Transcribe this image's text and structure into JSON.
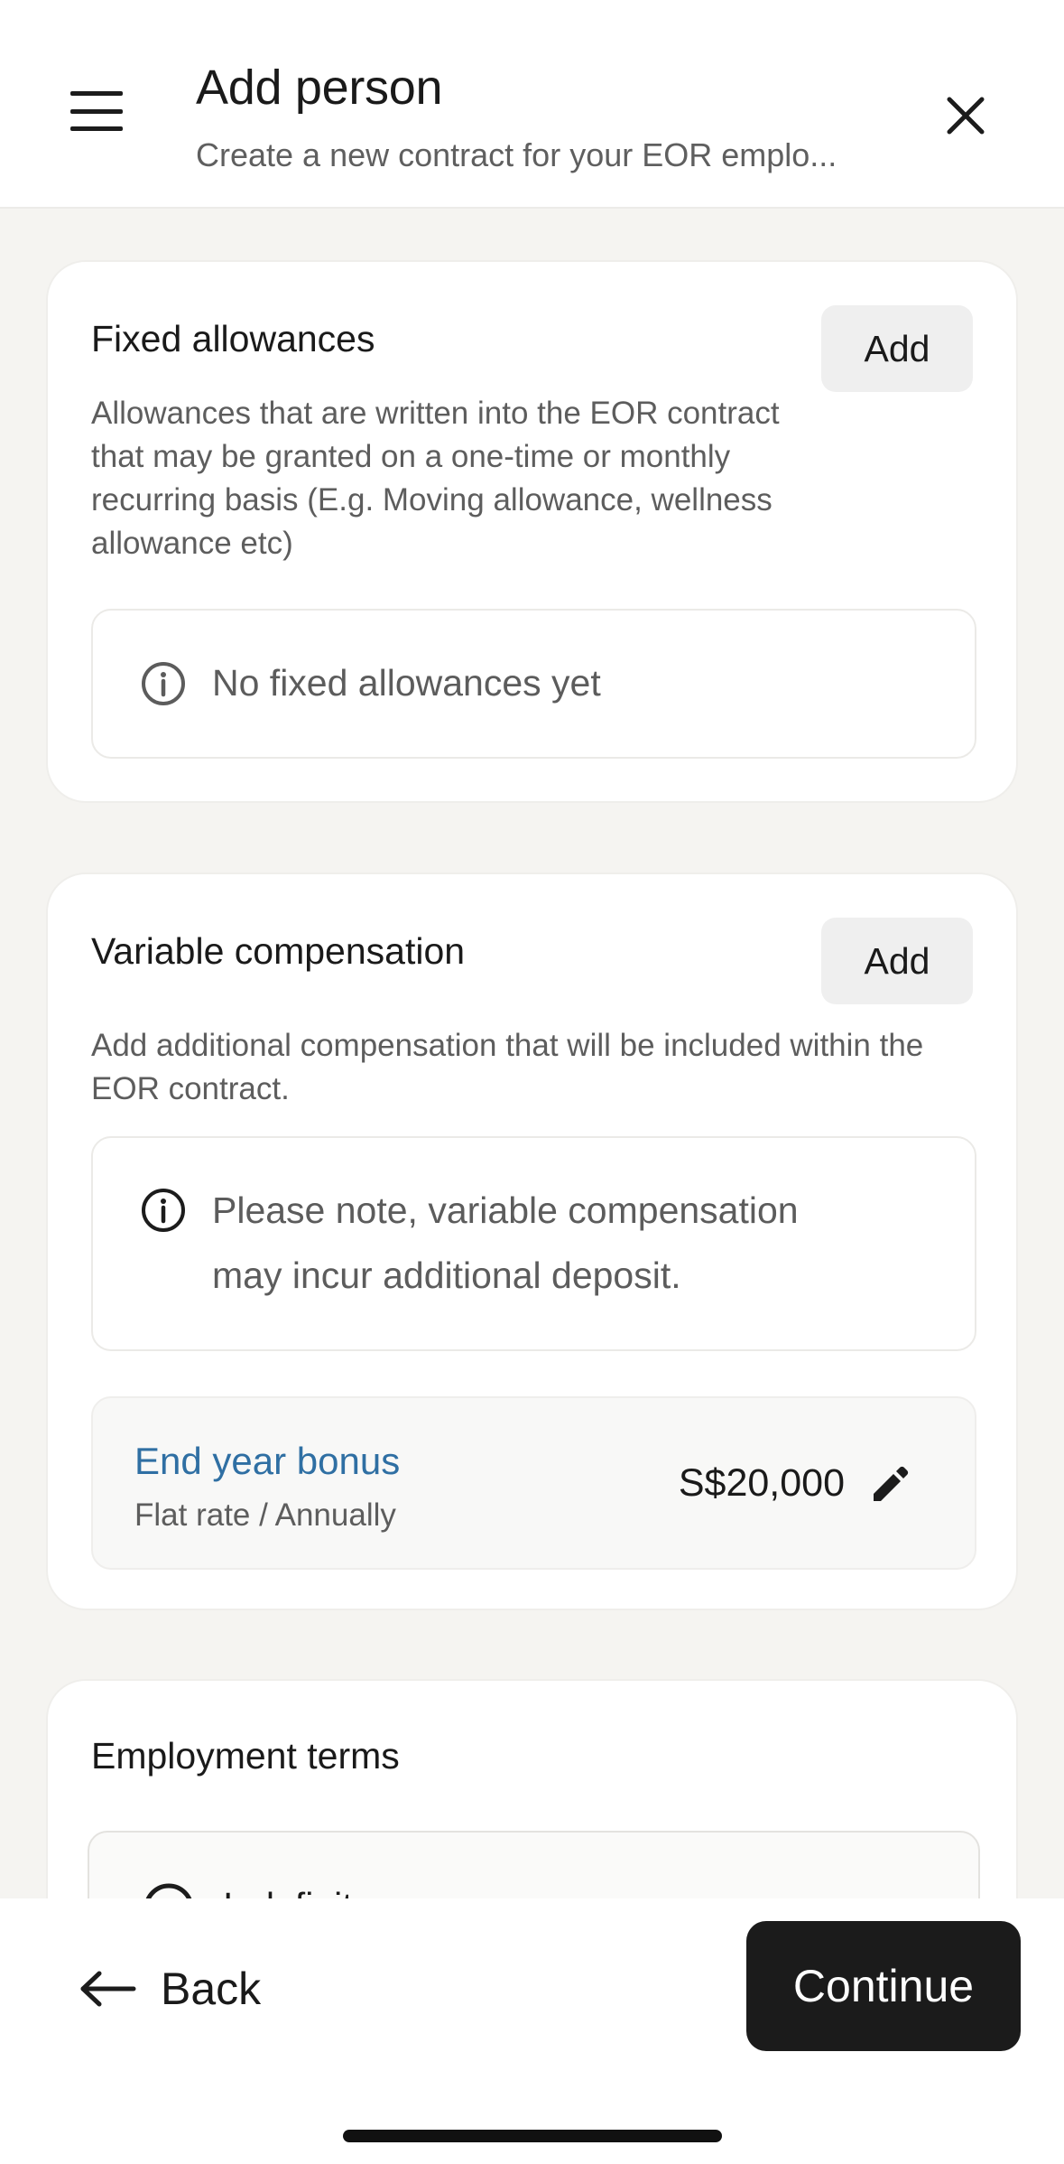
{
  "header": {
    "title": "Add person",
    "subtitle": "Create a new contract for your EOR emplo..."
  },
  "fixed_allowances": {
    "title": "Fixed allowances",
    "add_label": "Add",
    "description": "Allowances that are written into the EOR contract that may be granted on a one-time or monthly recurring basis (E.g. Moving allowance, wellness allowance etc)",
    "empty_text": "No fixed allowances yet"
  },
  "variable_compensation": {
    "title": "Variable compensation",
    "add_label": "Add",
    "description": "Add additional compensation that will be included within the EOR contract.",
    "note_line1": "Please note, variable compensation",
    "note_line2": "may incur additional deposit.",
    "items": [
      {
        "name": "End year bonus",
        "meta": "Flat rate / Annually",
        "amount": "S$20,000"
      }
    ]
  },
  "employment_terms": {
    "title": "Employment terms",
    "option_label": "Indefinite"
  },
  "footer": {
    "back_label": "Back",
    "continue_label": "Continue"
  },
  "colors": {
    "accent_link": "#2f6fa3",
    "primary_button": "#1b1b1b",
    "page_background": "#f5f4f1"
  },
  "icons": {
    "menu": "hamburger-menu-icon",
    "close": "close-icon",
    "info": "info-circle-icon",
    "edit": "pencil-icon",
    "back": "arrow-left-icon",
    "radio": "radio-icon"
  }
}
